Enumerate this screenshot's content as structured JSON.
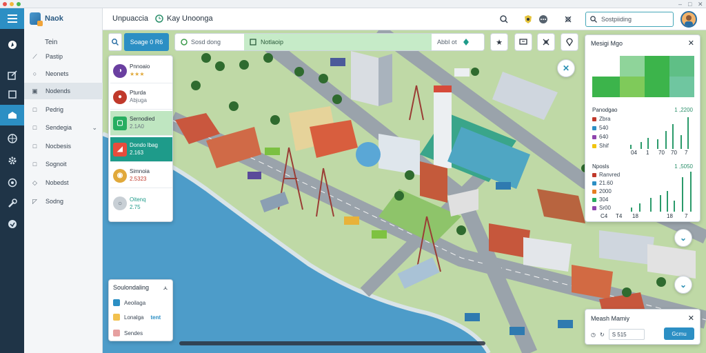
{
  "window": {
    "minimize": "–",
    "maximize": "□",
    "close": "✕"
  },
  "sidebar": {
    "logo": "Naok",
    "heading": "Tein",
    "items": [
      {
        "label": "Pastip",
        "icon": "ruler-icon"
      },
      {
        "label": "Neonets",
        "icon": "circle-icon"
      },
      {
        "label": "Nodends",
        "icon": "image-icon"
      },
      {
        "label": "Pedrig",
        "icon": "square-icon"
      },
      {
        "label": "Sendegia",
        "icon": "square-icon"
      },
      {
        "label": "Nocbesis",
        "icon": "square-icon"
      },
      {
        "label": "Sognoit",
        "icon": "square-icon"
      },
      {
        "label": "Nobedst",
        "icon": "tag-icon"
      },
      {
        "label": "Sodng",
        "icon": "pencil-icon"
      }
    ]
  },
  "topbar": {
    "app_title": "Unpuaccia",
    "user_label": "Kay Unoonga",
    "search_placeholder": "Sostpiiding"
  },
  "toolbar": {
    "search_btn": "Soage 0 R6",
    "search_placeholder": "Sosd dong",
    "green_label": "Notlaoip",
    "right_label": "AbbI ot"
  },
  "poi_list": [
    {
      "name": "Pnnoaio",
      "sub": "★★★",
      "color": "#6a3fa0"
    },
    {
      "name": "Pturda",
      "sub": "Abjuga",
      "color": "#c0392b"
    },
    {
      "name": "Sernodied",
      "sub": "2.1A0",
      "color": "#27ae60"
    },
    {
      "name": "Dondo lbag",
      "sub": "2.163",
      "color": "#e74c3c"
    },
    {
      "name": "Simnoia",
      "sub": "2.5323",
      "color": "#e1a93b"
    },
    {
      "name": "Oitenq",
      "sub": "2.75",
      "color": "#95a5a6"
    }
  ],
  "legend_panel": {
    "title": "Soulondaling",
    "rows": [
      {
        "label": "Aeoilaga",
        "color": "#2c8fc4",
        "extra": ""
      },
      {
        "label": "Lonalga",
        "color": "#f2c14e",
        "extra": "tent"
      },
      {
        "label": "Sendes",
        "color": "#e6a0a0",
        "extra": ""
      }
    ]
  },
  "chart_panel": {
    "title": "Mesigi Mgo",
    "sub1": "Panodgao",
    "num1": "1 ,2200",
    "legend1": [
      {
        "label": "Zbra",
        "color": "#c0392b"
      },
      {
        "label": "540",
        "color": "#2c8fc4"
      },
      {
        "label": "640",
        "color": "#8e44ad"
      },
      {
        "label": "Shif",
        "color": "#f1c40f"
      }
    ],
    "ticks1": [
      "04",
      "1",
      "70",
      "70",
      "7"
    ],
    "sub2": "Nposls",
    "num2": "1 ,5050",
    "legend2": [
      {
        "label": "Ranvred",
        "color": "#c0392b"
      },
      {
        "label": "21.60",
        "color": "#2c8fc4"
      },
      {
        "label": "2000",
        "color": "#e67e22"
      },
      {
        "label": "304",
        "color": "#27ae60"
      },
      {
        "label": "Sr00",
        "color": "#8e44ad"
      }
    ],
    "ticks2": [
      "C4",
      "T4",
      "18",
      "18",
      "7"
    ]
  },
  "measure_panel": {
    "title": "Meash Mamiy",
    "value": "S 515",
    "button": "Gcmu"
  },
  "colors": {
    "accent": "#2c8fc4",
    "rail": "#1f3447",
    "green": "#c6ebc8",
    "teal": "#1e9b8a"
  }
}
